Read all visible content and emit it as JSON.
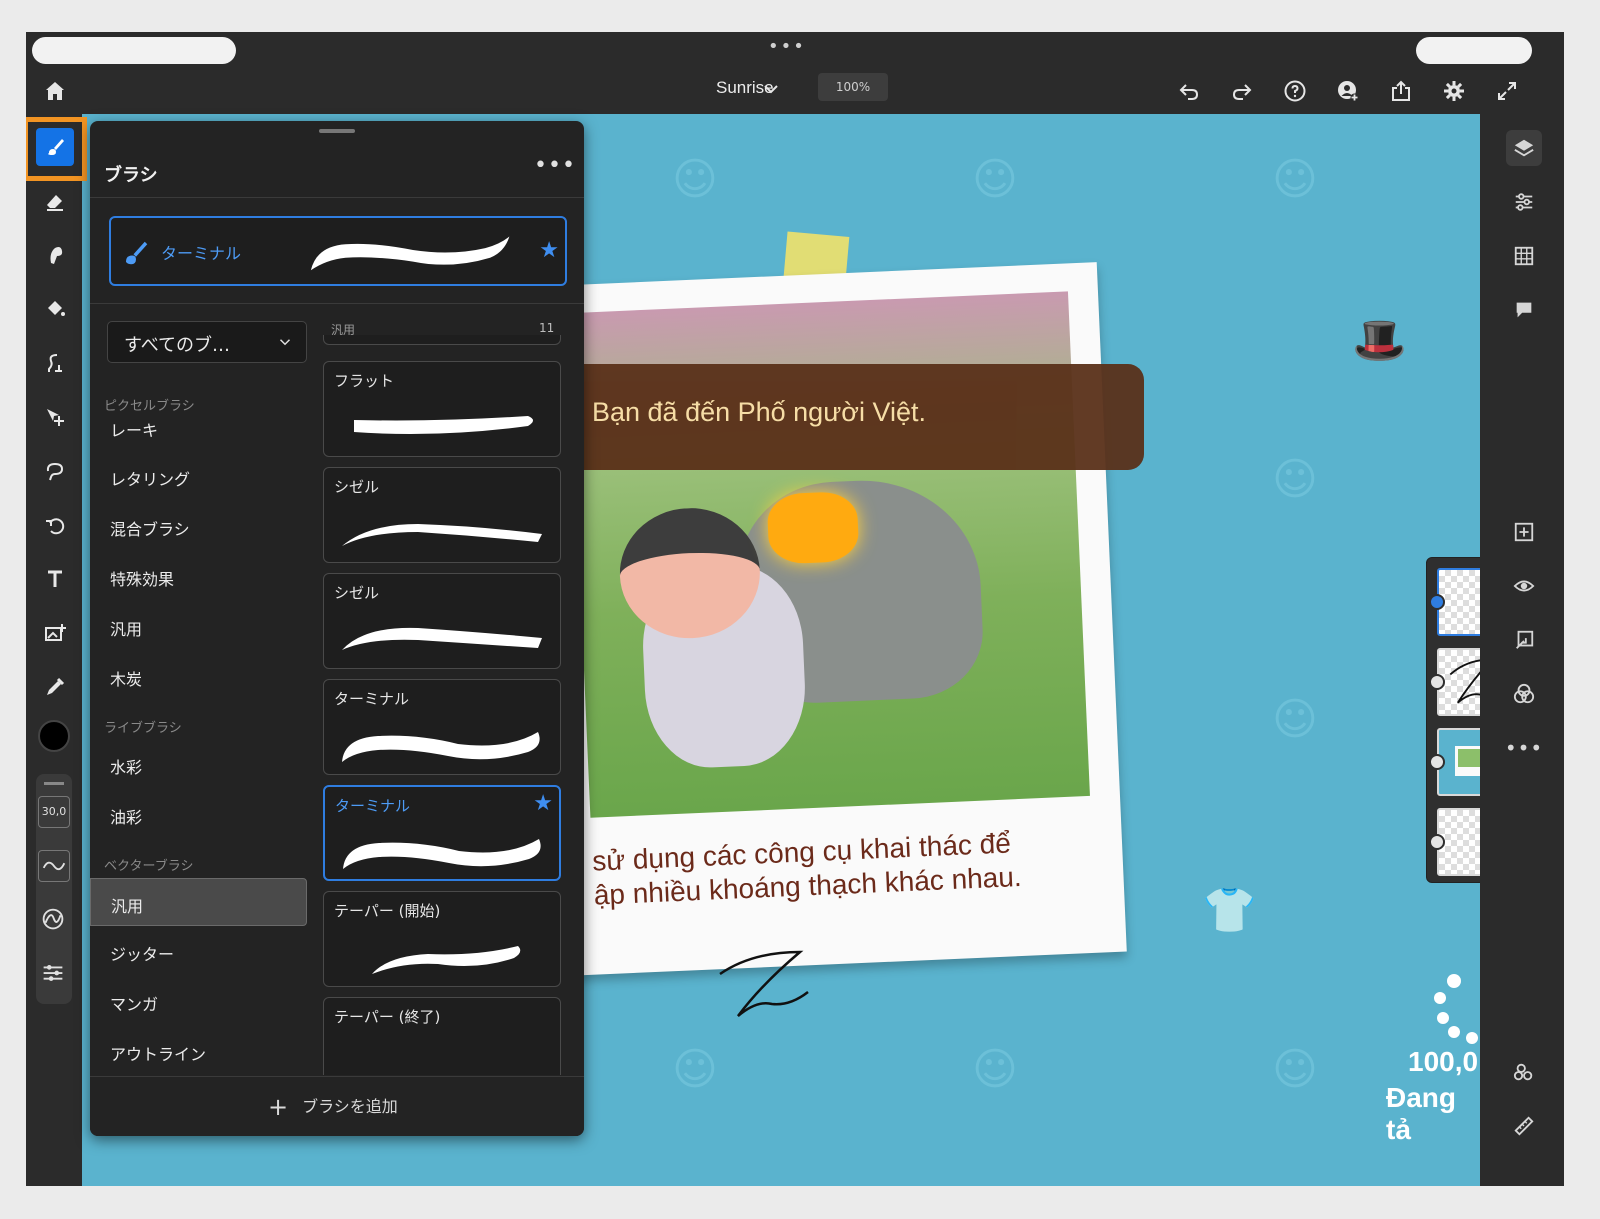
{
  "toolbar": {
    "doc_title": "Sunrise",
    "zoom": "100%"
  },
  "brush_panel": {
    "title": "ブラシ",
    "current_brush": "ターミナル",
    "category_select": "すべてのブ…",
    "categories": [
      {
        "type": "group",
        "label": "ピクセルブラシ"
      },
      {
        "type": "item",
        "label": "レーキ"
      },
      {
        "type": "item",
        "label": "レタリング"
      },
      {
        "type": "item",
        "label": "混合ブラシ"
      },
      {
        "type": "item",
        "label": "特殊効果"
      },
      {
        "type": "item",
        "label": "汎用"
      },
      {
        "type": "item",
        "label": "木炭"
      },
      {
        "type": "group",
        "label": "ライブブラシ"
      },
      {
        "type": "item",
        "label": "水彩"
      },
      {
        "type": "item",
        "label": "油彩"
      },
      {
        "type": "group",
        "label": "ベクターブラシ"
      },
      {
        "type": "item",
        "label": "汎用",
        "selected": true
      },
      {
        "type": "item",
        "label": "ジッター"
      },
      {
        "type": "item",
        "label": "マンガ"
      },
      {
        "type": "item",
        "label": "アウトライン"
      }
    ],
    "list_header_label": "汎用",
    "list_header_count": "11",
    "brushes": [
      {
        "label": "フラット"
      },
      {
        "label": "シゼル"
      },
      {
        "label": "シゼル"
      },
      {
        "label": "ターミナル"
      },
      {
        "label": "ターミナル",
        "selected": true,
        "favorite": true
      },
      {
        "label": "テーパー (開始)"
      },
      {
        "label": "テーパー (終了)"
      }
    ],
    "add_brush": "ブラシを追加"
  },
  "tool_size": "30,0",
  "canvas": {
    "banner_text": "Bạn đã đến Phố người Việt.",
    "caption_line1": "sử dụng các công cụ khai thác để",
    "caption_line2": "ập nhiều khoáng thạch khác nhau.",
    "progress_value": "100,0",
    "progress_label": "Đang tả"
  },
  "colors": {
    "accent": "#1473e6",
    "highlight": "#f29423",
    "canvas_bg": "#5ab3ce",
    "current_color": "#000000"
  }
}
